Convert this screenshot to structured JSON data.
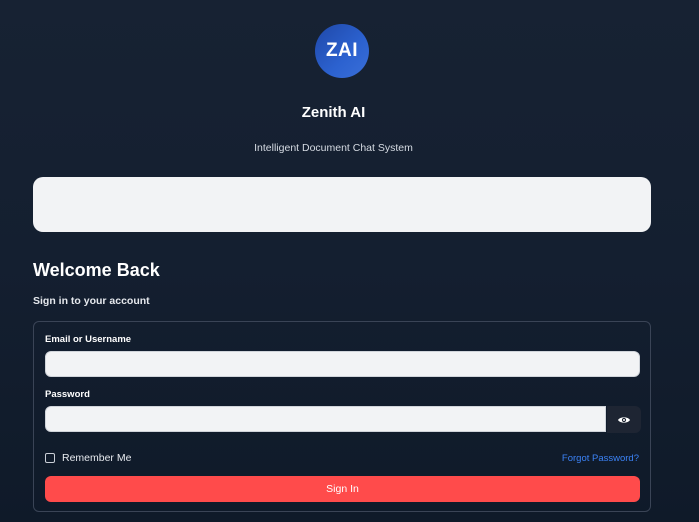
{
  "brand": {
    "logo_text": "ZAI",
    "name": "Zenith AI",
    "tagline": "Intelligent Document Chat System"
  },
  "login": {
    "heading": "Welcome Back",
    "subheading": "Sign in to your account",
    "email_label": "Email or Username",
    "email_value": "",
    "password_label": "Password",
    "password_value": "",
    "remember_label": "Remember Me",
    "remember_checked": false,
    "forgot_label": "Forgot Password?",
    "submit_label": "Sign In"
  },
  "icons": {
    "password_toggle": "eye-icon"
  },
  "colors": {
    "background": "#141f30",
    "logo_gradient_start": "#1f48a8",
    "logo_gradient_end": "#3a6fd8",
    "primary_button": "#ff4b4b",
    "link": "#3b82f6",
    "input_background": "#f2f3f5"
  }
}
